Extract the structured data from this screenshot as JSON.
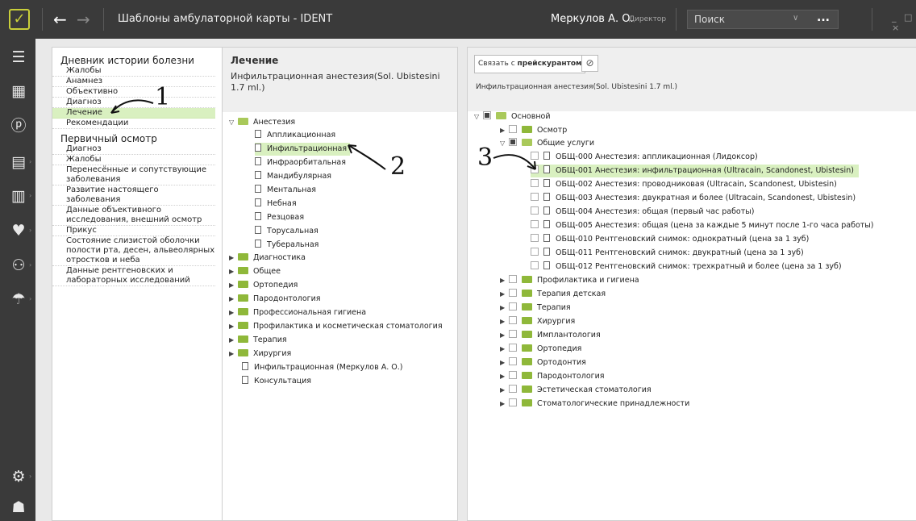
{
  "window": {
    "title": "Шаблоны амбулаторной карты - IDENT",
    "user": "Меркулов А. О.",
    "role": "Директор",
    "search_placeholder": "Поиск",
    "search_more": "...",
    "controls": "_ □ ×"
  },
  "sidebar": {
    "icons": [
      "schedule-list-icon",
      "calendar-icon",
      "payment-icon",
      "cash-register-icon",
      "reports-icon",
      "tooth-icon",
      "patients-icon",
      "umbrella-icon",
      "settings-icon",
      "user-icon"
    ]
  },
  "pane1": {
    "sections": [
      {
        "title": "Дневник истории болезни",
        "items": [
          "Жалобы",
          "Анамнез",
          "Объективно",
          "Диагноз",
          "Лечение",
          "Рекомендации"
        ]
      },
      {
        "title": "Первичный осмотр",
        "items": [
          "Диагноз",
          "Жалобы",
          "Перенесённые и сопутствующие заболевания",
          "Развитие настоящего заболевания",
          "Данные объективного исследования, внешний осмотр",
          "Прикус",
          "Состояние слизистой оболочки полости рта, десен, альвеолярных отростков и неба",
          "Данные рентгеновских и лабораторных исследований"
        ]
      }
    ]
  },
  "pane2": {
    "header": "Лечение",
    "subtitle": "Инфильтрационная анестезия(Sol. Ubistesini 1.7 ml.)",
    "tree": {
      "open_folder": "Анестезия",
      "children": [
        "Аппликационная",
        "Инфильтрационная",
        "Инфраорбитальная",
        "Мандибулярная",
        "Ментальная",
        "Небная",
        "Резцовая",
        "Торусальная",
        "Туберальная"
      ],
      "folders": [
        "Диагностика",
        "Общее",
        "Ортопедия",
        "Пародонтология",
        "Профессиональная гигиена",
        "Профилактика и косметическая стоматология",
        "Терапия",
        "Хирургия"
      ],
      "docs": [
        "Инфильтрационная (Меркулов А. О.)",
        "Консультация"
      ]
    }
  },
  "pane3": {
    "link_prefix": "Связать с ",
    "link_bold": "прейскурантом",
    "clear_icon": "⊘",
    "subtitle": "Инфильтрационная анестезия(Sol. Ubistesini 1.7 ml.)",
    "root": "Основной",
    "osmotr": "Осмотр",
    "general": "Общие услуги",
    "services": [
      "ОБЩ-000 Анестезия: аппликационная (Лидоксор)",
      "ОБЩ-001 Анестезия: инфильтрационная (Ultracain, Scandonest, Ubistesin)",
      "ОБЩ-002 Анестезия: проводниковая (Ultracain, Scandonest, Ubistesin)",
      "ОБЩ-003 Анестезия: двукратная и более (Ultracain, Scandonest, Ubistesin)",
      "ОБЩ-004 Анестезия: общая (первый час работы)",
      "ОБЩ-005 Анестезия: общая (цена за каждые 5 минут после 1-го часа работы)",
      "ОБЩ-010 Рентгеновский снимок: однократный (цена за 1 зуб)",
      "ОБЩ-011 Рентгеновский снимок: двукратный (цена за 1 зуб)",
      "ОБЩ-012 Рентгеновский снимок: трехкратный и более (цена за 1 зуб)"
    ],
    "folders": [
      "Профилактика и гигиена",
      "Терапия детская",
      "Терапия",
      "Хирургия",
      "Имплантология",
      "Ортопедия",
      "Ортодонтия",
      "Пародонтология",
      "Эстетическая стоматология",
      "Стоматологические принадлежности"
    ]
  },
  "annotations": [
    "1",
    "2",
    "3"
  ]
}
